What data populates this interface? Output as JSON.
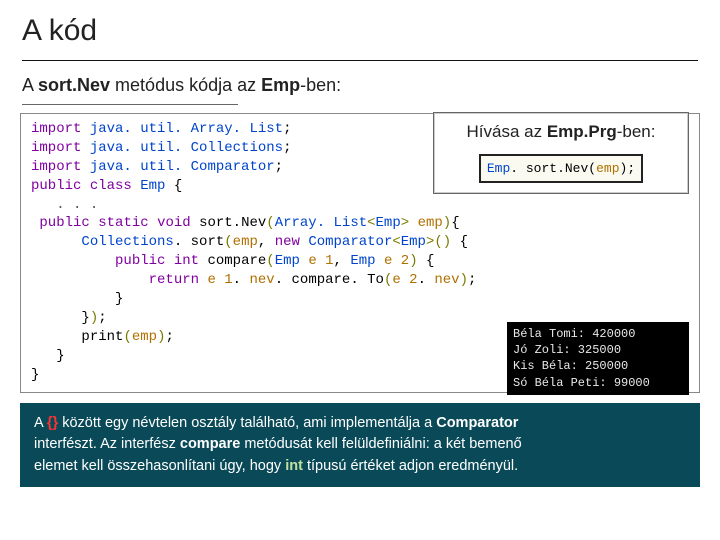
{
  "title": "A kód",
  "subtitle_prefix": "A ",
  "subtitle_method": "sort.Nev",
  "subtitle_mid": " metódus kódja az ",
  "subtitle_class": "Emp",
  "subtitle_suffix": "-ben:",
  "callbox": {
    "title_prefix": "Hívása az ",
    "title_class": "Emp.Prg",
    "title_suffix": "-ben:",
    "code_obj": "Emp",
    "code_dot": ". ",
    "code_fn": "sort.Nev",
    "code_paren_open": "(",
    "code_arg": "emp",
    "code_paren_close": ");"
  },
  "code": {
    "kw_import": "import",
    "kw_public": "public",
    "kw_class": "class",
    "kw_static": "static",
    "kw_void": "void",
    "kw_new": "new",
    "kw_int": "int",
    "kw_return": "return",
    "cls_arraylist_pkg": "java. util. Array. List",
    "cls_collections_pkg": "java. util. Collections",
    "cls_comparator_pkg": "java. util. Comparator",
    "cls_emp": "Emp",
    "cls_arraylist": "Array. List",
    "cls_comparator": "Comparator",
    "cls_collections": "Collections",
    "fn_sortnev": "sort.Nev",
    "fn_compare": "compare",
    "fn_compareto": "compare. To",
    "fn_print": "print",
    "fn_sort": "sort",
    "var_emp": "emp",
    "var_e1": "e 1",
    "var_e2": "e 2",
    "fld_nev": "nev",
    "dots": ". . .",
    "ob": "{",
    "cb": "}",
    "op": "(",
    "cp": ")",
    "lt": "<",
    "gt": ">",
    "sc": ";",
    "dot": ". ",
    "comma": ", "
  },
  "output": [
    "Béla Tomi: 420000",
    "Jó Zoli: 325000",
    "Kis Béla: 250000",
    "Só Béla Peti: 99000"
  ],
  "footer": {
    "part1_a": "A ",
    "part1_braces": "{}",
    "part1_b": " között egy névtelen osztály található, ami implementálja a ",
    "part1_class": "Comparator",
    "part2_a": "interfészt. Az interfész ",
    "part2_method": "compare",
    "part2_b": " metódusát kell felüldefiniálni: a két bemenő",
    "part3_a": "elemet kell összehasonlítani úgy, hogy ",
    "part3_type": "int",
    "part3_b": " típusú értéket adjon eredményül."
  }
}
